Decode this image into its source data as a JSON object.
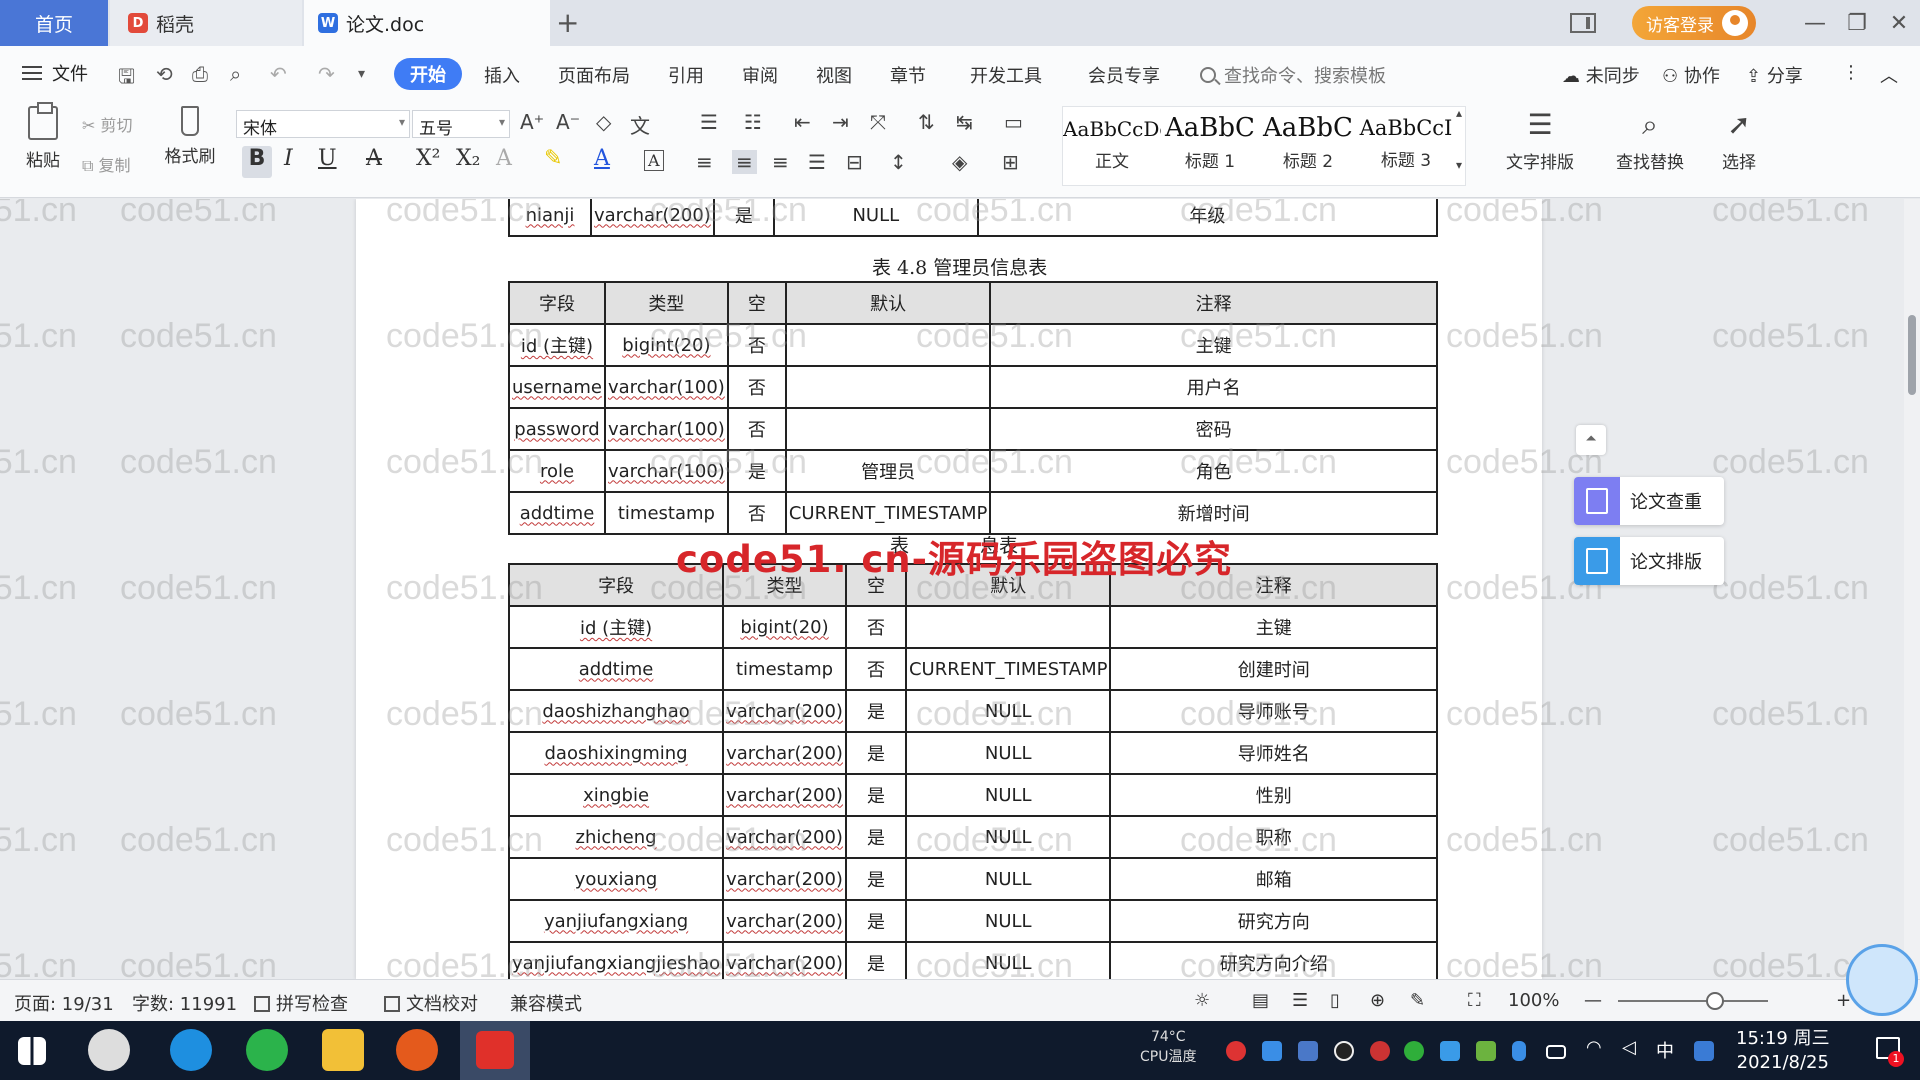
{
  "tabs": {
    "home": "首页",
    "daoke": "稻壳",
    "doc": "论文.doc",
    "add": "+"
  },
  "titlebar": {
    "login": "访客登录"
  },
  "menu": {
    "file": "文件",
    "items": [
      "开始",
      "插入",
      "页面布局",
      "引用",
      "审阅",
      "视图",
      "章节",
      "开发工具",
      "会员专享"
    ],
    "search_placeholder": "查找命令、搜索模板",
    "right": [
      "未同步",
      "协作",
      "分享"
    ]
  },
  "ribbon": {
    "paste": "粘贴",
    "cut": "剪切",
    "copy": "复制",
    "format_painter": "格式刷",
    "font_name": "宋体",
    "font_size": "五号",
    "styles": [
      {
        "sample": "AaBbCcDd",
        "name": "正文"
      },
      {
        "sample": "AaBbC",
        "name": "标题 1"
      },
      {
        "sample": "AaBbC",
        "name": "标题 2"
      },
      {
        "sample": "AaBbCcI",
        "name": "标题 3"
      }
    ],
    "text_layout": "文字排版",
    "find_replace": "查找替换",
    "select": "选择"
  },
  "doc": {
    "top_row": [
      "nianji",
      "varchar(200)",
      "是",
      "NULL",
      "年级"
    ],
    "caption_admin": "表 4.8  管理员信息表",
    "headers": [
      "字段",
      "类型",
      "空",
      "默认",
      "注释"
    ],
    "admin_rows": [
      [
        "id (主键)",
        "bigint(20)",
        "否",
        "",
        "主键"
      ],
      [
        "username",
        "varchar(100)",
        "否",
        "",
        "用户名"
      ],
      [
        "password",
        "varchar(100)",
        "否",
        "",
        "密码"
      ],
      [
        "role",
        "varchar(100)",
        "是",
        "管理员",
        "角色"
      ],
      [
        "addtime",
        "timestamp",
        "否",
        "CURRENT_TIMESTAMP",
        "新增时间"
      ]
    ],
    "caption_teacher_partial": "表",
    "caption_teacher_tail": "息表",
    "red_banner": "code51. cn-源码乐园盗图必究",
    "teacher_rows": [
      [
        "id (主键)",
        "bigint(20)",
        "否",
        "",
        "主键"
      ],
      [
        "addtime",
        "timestamp",
        "否",
        "CURRENT_TIMESTAMP",
        "创建时间"
      ],
      [
        "daoshizhanghao",
        "varchar(200)",
        "是",
        "NULL",
        "导师账号"
      ],
      [
        "daoshixingming",
        "varchar(200)",
        "是",
        "NULL",
        "导师姓名"
      ],
      [
        "xingbie",
        "varchar(200)",
        "是",
        "NULL",
        "性别"
      ],
      [
        "zhicheng",
        "varchar(200)",
        "是",
        "NULL",
        "职称"
      ],
      [
        "youxiang",
        "varchar(200)",
        "是",
        "NULL",
        "邮箱"
      ],
      [
        "yanjiufangxiang",
        "varchar(200)",
        "是",
        "NULL",
        "研究方向"
      ],
      [
        "yanjiufangxiangjieshao",
        "varchar(200)",
        "是",
        "NULL",
        "研究方向介绍"
      ]
    ],
    "watermark": "code51.cn"
  },
  "side_panel": {
    "check": "论文查重",
    "layout": "论文排版"
  },
  "statusbar": {
    "page": "页面: 19/31",
    "words": "字数: 11991",
    "spell": "拼写检查",
    "proof": "文档校对",
    "compat": "兼容模式",
    "zoom": "100%"
  },
  "taskbar": {
    "cpu_temp": "74°C",
    "cpu_label": "CPU温度",
    "ime": "中",
    "time": "15:19 周三",
    "date": "2021/8/25",
    "notif_count": "1"
  },
  "colors": {
    "accent": "#3f7cf5",
    "home_tab": "#4a76d6",
    "banner": "#d7262a",
    "taskbar": "#0f1a2c"
  }
}
